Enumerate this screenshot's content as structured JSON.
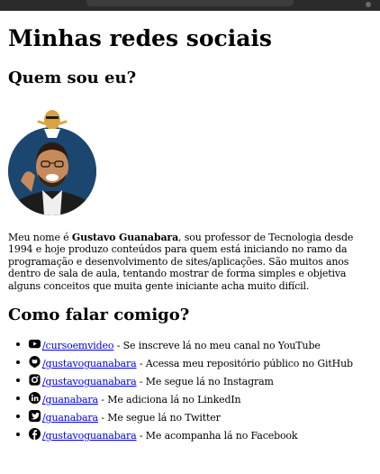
{
  "page": {
    "title": "Minhas redes sociais"
  },
  "about": {
    "heading": "Quem sou eu?",
    "avatar_icon": "profile-photo",
    "bio_before": "Meu nome é ",
    "bio_name": "Gustavo Guanabara",
    "bio_after": ", sou professor de Tecnologia desde 1994 e hoje produzo conteúdos para quem está iniciando no ramo da programação e desenvolvimento de sites/aplicações. São muitos anos dentro de sala de aula, tentando mostrar de forma simples e objetiva alguns conceitos que muita gente iniciante acha muito difícil."
  },
  "contact": {
    "heading": "Como falar comigo?",
    "items": [
      {
        "network": "youtube",
        "icon": "youtube-icon",
        "handle": "/cursoemvideo",
        "description": " - Se inscreve lá no meu canal no YouTube"
      },
      {
        "network": "github",
        "icon": "github-icon",
        "handle": "/gustavoguanabara",
        "description": " - Acessa meu repositório público no GitHub"
      },
      {
        "network": "instagram",
        "icon": "instagram-icon",
        "handle": "/gustavoguanabara",
        "description": " - Me segue lá no Instagram"
      },
      {
        "network": "linkedin",
        "icon": "linkedin-icon",
        "handle": "/guanabara",
        "description": " - Me adiciona lá no LinkedIn"
      },
      {
        "network": "twitter",
        "icon": "twitter-icon",
        "handle": "/guanabara",
        "description": " - Me segue lá no Twitter"
      },
      {
        "network": "facebook",
        "icon": "facebook-icon",
        "handle": "/gustavoguanabara",
        "description": " - Me acompanha lá no Facebook"
      }
    ]
  },
  "colors": {
    "link": "#0000ee",
    "text": "#000000",
    "background": "#ffffff"
  }
}
